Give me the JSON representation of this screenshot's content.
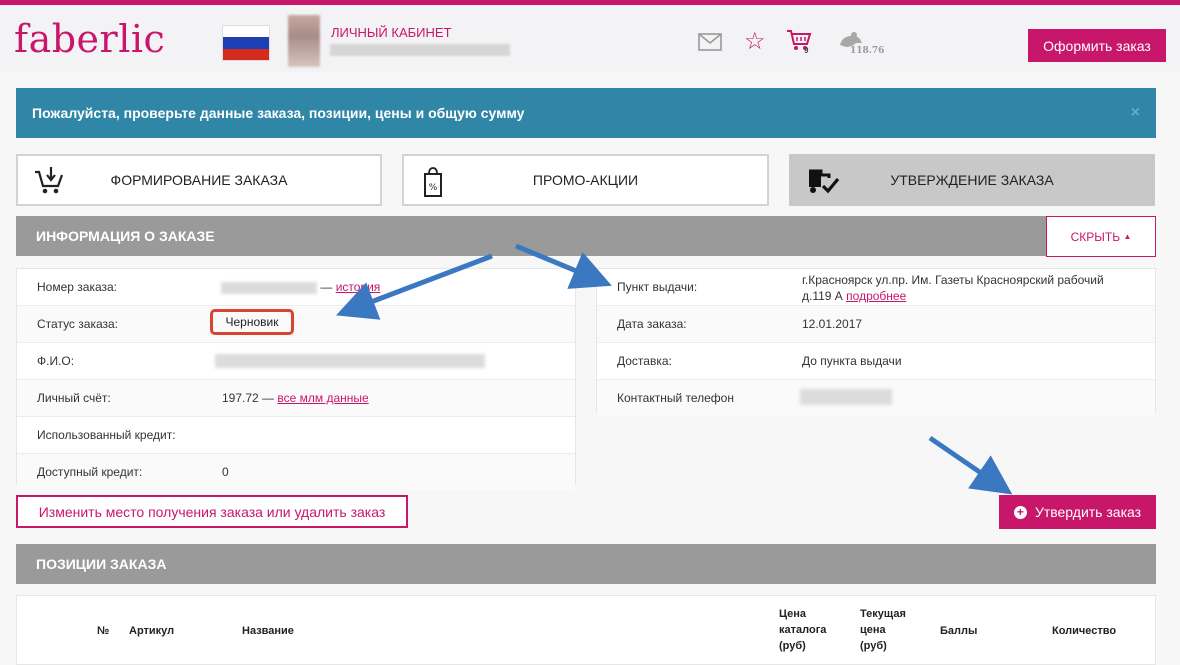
{
  "header": {
    "logo": "faberlic",
    "cabinet_label": "ЛИЧНЫЙ КАБИНЕТ",
    "cart_count": "9",
    "balance": "118.76",
    "order_button": "Оформить заказ",
    "flag_colors": [
      "#ffffff",
      "#1c3fb4",
      "#d52b1e"
    ],
    "accent": "#c8176b"
  },
  "alert": {
    "text": "Пожалуйста, проверьте данные заказа, позиции, цены и общую сумму",
    "close": "×",
    "color": "#3086a6"
  },
  "steps": [
    {
      "label": "ФОРМИРОВАНИЕ ЗАКАЗА",
      "icon": "cart-download-icon",
      "active": false
    },
    {
      "label": "ПРОМО-АКЦИИ",
      "icon": "percent-tag-icon",
      "active": false
    },
    {
      "label": "УТВЕРЖДЕНИЕ ЗАКАЗА",
      "icon": "truck-check-icon",
      "active": true
    }
  ],
  "order_info": {
    "title": "ИНФОРМАЦИЯ О ЗАКАЗЕ",
    "hide_button": "СКРЫТЬ",
    "left": {
      "order_number_label": "Номер заказа:",
      "order_number_sep": "—",
      "history_link": "история",
      "status_label": "Статус заказа:",
      "status_value": "Черновик",
      "fio_label": "Ф.И.О:",
      "account_label": "Личный счёт:",
      "account_value": "197.72 —",
      "account_link": "все млм данные",
      "used_credit_label": "Использованный кредит:",
      "available_credit_label": "Доступный кредит:",
      "available_credit_value": "0"
    },
    "right": {
      "pickup_label": "Пункт выдачи:",
      "pickup_line1": "г.Красноярск ул.пр. Им. Газеты Красноярский рабочий",
      "pickup_line2": "д.119 А",
      "pickup_more": "подробнее",
      "date_label": "Дата заказа:",
      "date_value": "12.01.2017",
      "delivery_label": "Доставка:",
      "delivery_value": "До пункта выдачи",
      "phone_label": "Контактный телефон"
    }
  },
  "actions": {
    "change_button": "Изменить место получения заказа или удалить заказ",
    "confirm_button": "Утвердить заказ"
  },
  "positions": {
    "title": "ПОЗИЦИИ ЗАКАЗА",
    "columns": {
      "num": "№",
      "article": "Артикул",
      "name": "Название",
      "catalog_price": [
        "Цена",
        "каталога",
        "(руб)"
      ],
      "current_price": [
        "Текущая",
        "цена",
        "(руб)"
      ],
      "points": "Баллы",
      "quantity": "Количество"
    }
  }
}
